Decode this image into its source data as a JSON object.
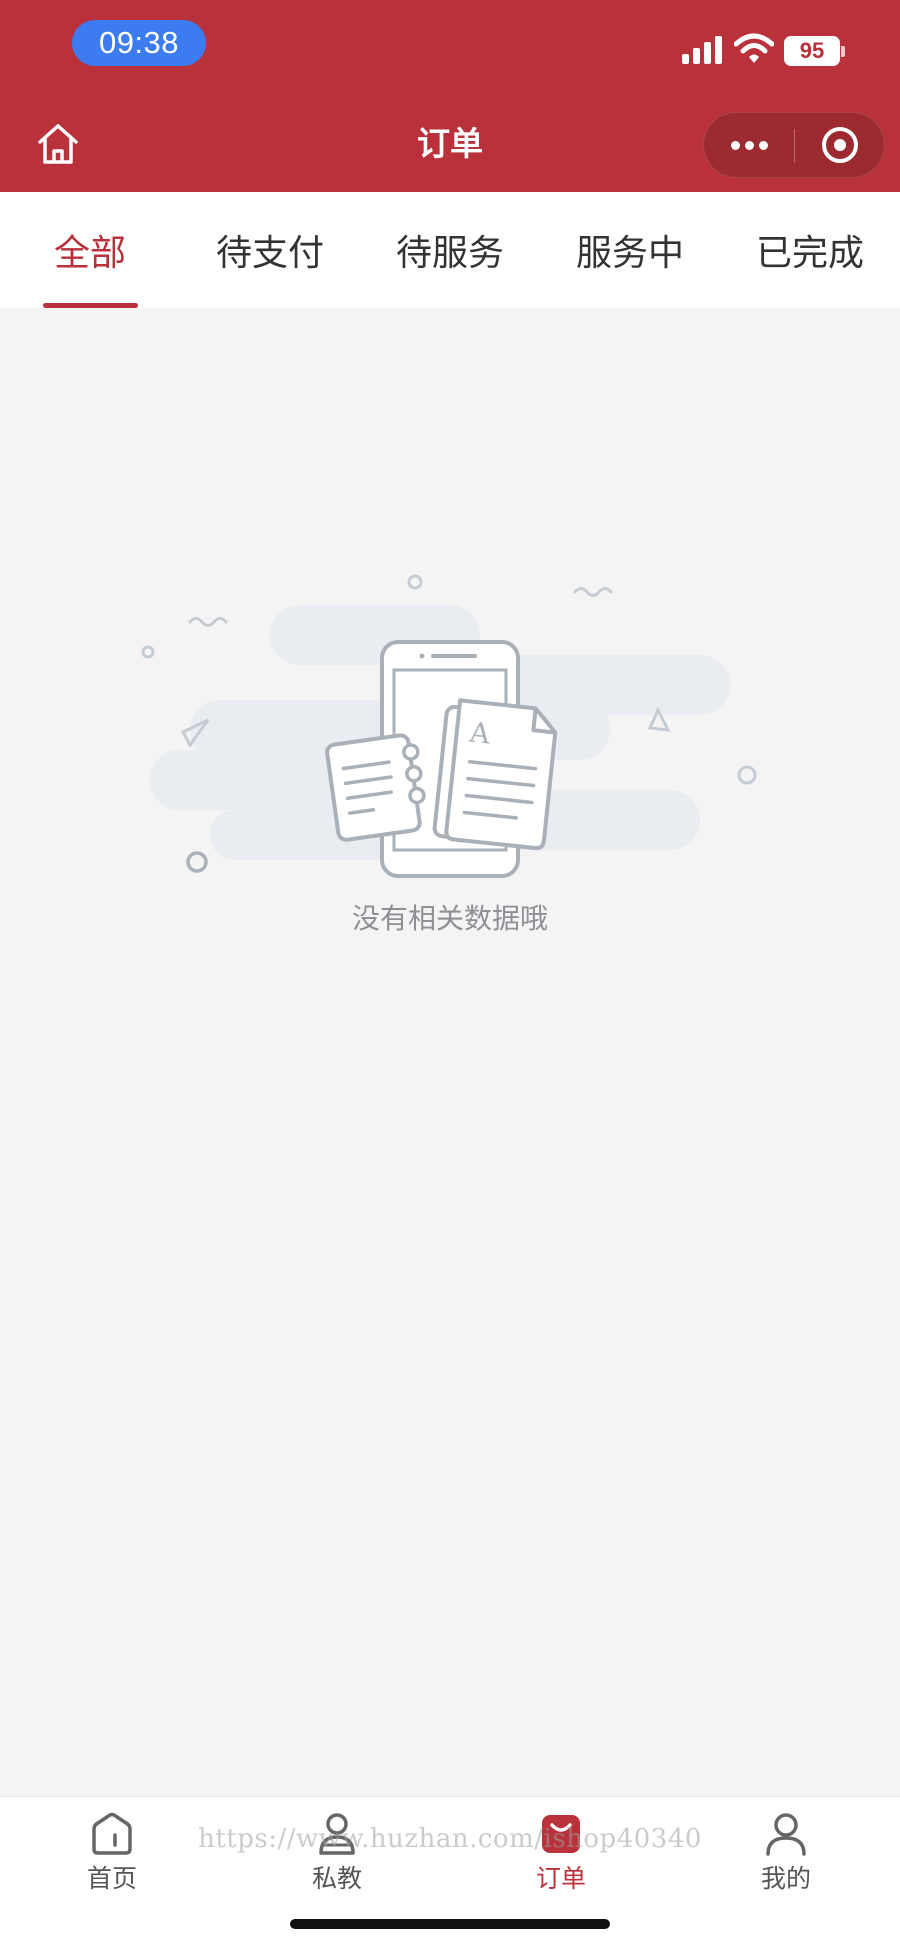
{
  "status_bar": {
    "time": "09:38",
    "battery": "95",
    "icons": [
      "signal-icon",
      "wifi-icon",
      "battery-icon"
    ]
  },
  "nav": {
    "title": "订单",
    "home_icon": "home-icon",
    "more_icon": "more-dots-icon",
    "close_icon": "target-close-icon"
  },
  "tabs": [
    {
      "label": "全部",
      "active": true
    },
    {
      "label": "待支付",
      "active": false
    },
    {
      "label": "待服务",
      "active": false
    },
    {
      "label": "服务中",
      "active": false
    },
    {
      "label": "已完成",
      "active": false
    }
  ],
  "empty_state": {
    "text": "没有相关数据哦",
    "illustration": "empty-documents-illustration"
  },
  "tabbar": {
    "items": [
      {
        "label": "首页",
        "icon": "home-tab-icon",
        "active": false
      },
      {
        "label": "私教",
        "icon": "coach-tab-icon",
        "active": false
      },
      {
        "label": "订单",
        "icon": "order-tab-icon",
        "active": true
      },
      {
        "label": "我的",
        "icon": "profile-tab-icon",
        "active": false
      }
    ]
  },
  "watermark": "https://www.huzhan.com/ishop40340",
  "colors": {
    "brand": "#b9313a",
    "background": "#f4f4f5",
    "time_pill": "#3d7bf0",
    "muted_text": "#8f9095"
  }
}
